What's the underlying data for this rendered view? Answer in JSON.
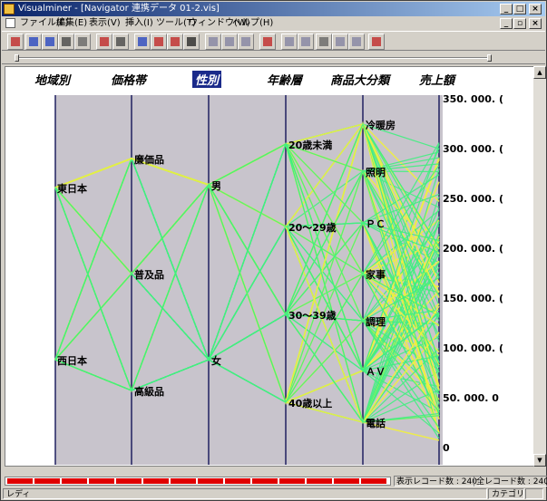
{
  "window": {
    "title": "Visualminer - [Navigator 連携データ 01-2.vis]"
  },
  "menu": [
    "ファイル(F)",
    "編集(E)",
    "表示(V)",
    "挿入(I)",
    "ツール(T)",
    "ウィンドウ(W)",
    "ヘルプ(H)"
  ],
  "toolbar_icons": [
    "open-icon",
    "save-icon",
    "save-as-icon",
    "print-icon",
    "print-preview-icon",
    "chart-icon",
    "table-icon",
    "parallel-coords-icon",
    "scatter-icon",
    "matrix-icon",
    "grid-icon",
    "zoom-in-icon",
    "zoom-out-icon",
    "zoom-fit-icon",
    "filter-icon",
    "layout-icon",
    "properties-icon",
    "brush-icon",
    "select-icon",
    "export-icon",
    "wav-icon"
  ],
  "axes": [
    {
      "label": "地域別",
      "categories": [
        "東日本",
        "西日本"
      ]
    },
    {
      "label": "価格帯",
      "categories": [
        "廉価品",
        "普及品",
        "高級品"
      ]
    },
    {
      "label": "性別",
      "categories": [
        "男",
        "女"
      ],
      "selected": true
    },
    {
      "label": "年齢層",
      "categories": [
        "20歳未満",
        "20～29歳",
        "30～39歳",
        "40歳以上"
      ]
    },
    {
      "label": "商品大分類",
      "categories": [
        "冷暖房",
        "照明",
        "ＰＣ",
        "家事",
        "調理",
        "ＡＶ",
        "電話"
      ]
    },
    {
      "label": "売上額",
      "ticks": [
        "350,000.0",
        "300,000.0",
        "250,000.0",
        "200,000.0",
        "150,000.0",
        "100,000.0",
        "50,000.0",
        "0"
      ]
    }
  ],
  "tick_display": [
    "350. 000. (",
    "300. 000. (",
    "250. 000. (",
    "200. 000. (",
    "150. 000. (",
    "100. 000. (",
    "50. 000. 0",
    "0"
  ],
  "status": {
    "display_records_label": "表示レコード数 : 240",
    "total_records_label": "全レコード数 : 240",
    "ready": "レディ",
    "category": "カテゴリ"
  },
  "colors": {
    "green_line": "#40f080",
    "yellow_line": "#f0f040",
    "axis": "#202060",
    "plot_bg": "#c8c4cc",
    "selected_header": "#1a2a8a",
    "red_bar": "#e00000"
  }
}
